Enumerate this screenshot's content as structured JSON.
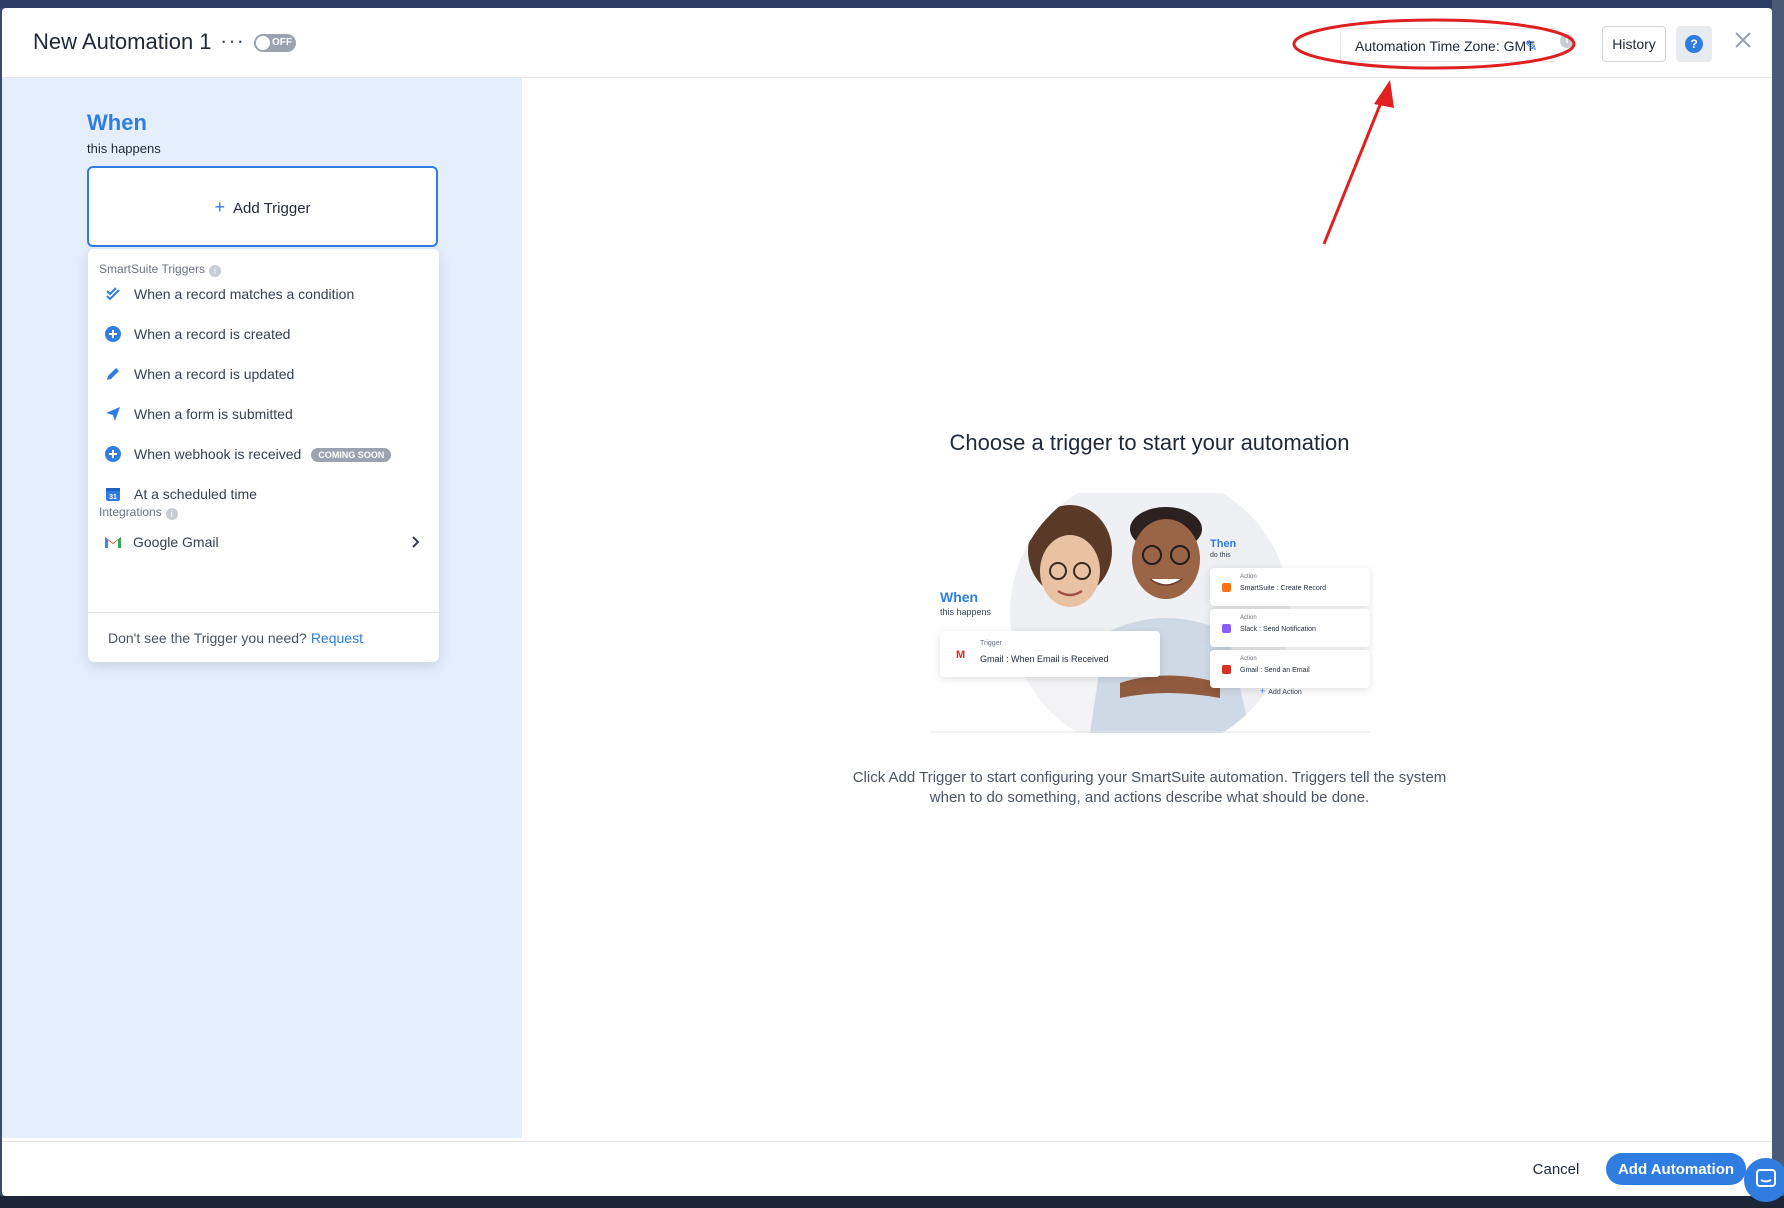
{
  "header": {
    "title": "New Automation 1",
    "more_label": "···",
    "toggle_label": "OFF",
    "timezone_label": "Automation Time Zone: GMT",
    "history_label": "History",
    "help_label": "?",
    "info_label": "i"
  },
  "left": {
    "when_title": "When",
    "when_subtitle": "this happens",
    "add_trigger_label": "Add Trigger",
    "smartsuite_section": "SmartSuite Triggers",
    "triggers": [
      {
        "label": "When a record matches a condition",
        "icon": "double-check-icon"
      },
      {
        "label": "When a record is created",
        "icon": "plus-circle-icon"
      },
      {
        "label": "When a record is updated",
        "icon": "pencil-icon"
      },
      {
        "label": "When a form is submitted",
        "icon": "send-icon"
      },
      {
        "label": "When webhook is received",
        "icon": "plus-circle-icon",
        "badge": "COMING SOON"
      },
      {
        "label": "At a scheduled time",
        "icon": "calendar-icon",
        "calendar_day": "31"
      }
    ],
    "integrations_section": "Integrations",
    "integrations": [
      {
        "label": "Google Gmail",
        "icon": "gmail-icon"
      }
    ],
    "footer_text": "Don't see the Trigger you need?",
    "footer_link": "Request"
  },
  "main": {
    "title": "Choose a trigger to start your automation",
    "description_line1": "Click Add Trigger to start configuring your SmartSuite automation. Triggers tell the system",
    "description_line2": "when to do something, and actions describe what should be done.",
    "illustration": {
      "when": "When",
      "when_sub": "this happens",
      "then": "Then",
      "then_sub": "do this",
      "trigger_small": "Trigger",
      "trigger_text": "Gmail : When Email is Received",
      "actions": [
        {
          "small": "Action",
          "text": "SmartSuite : Create Record",
          "color": "#f97316"
        },
        {
          "small": "Action",
          "text": "Slack : Send Notification",
          "color": "#8b5cf6"
        },
        {
          "small": "Action",
          "text": "Gmail : Send an Email",
          "color": "#d93025"
        }
      ],
      "add_action": "Add Action"
    }
  },
  "footer": {
    "cancel_label": "Cancel",
    "add_label": "Add Automation"
  },
  "colors": {
    "accent": "#2f7de1",
    "left_panel_bg": "#e4eefc",
    "annotation": "#e02020"
  }
}
